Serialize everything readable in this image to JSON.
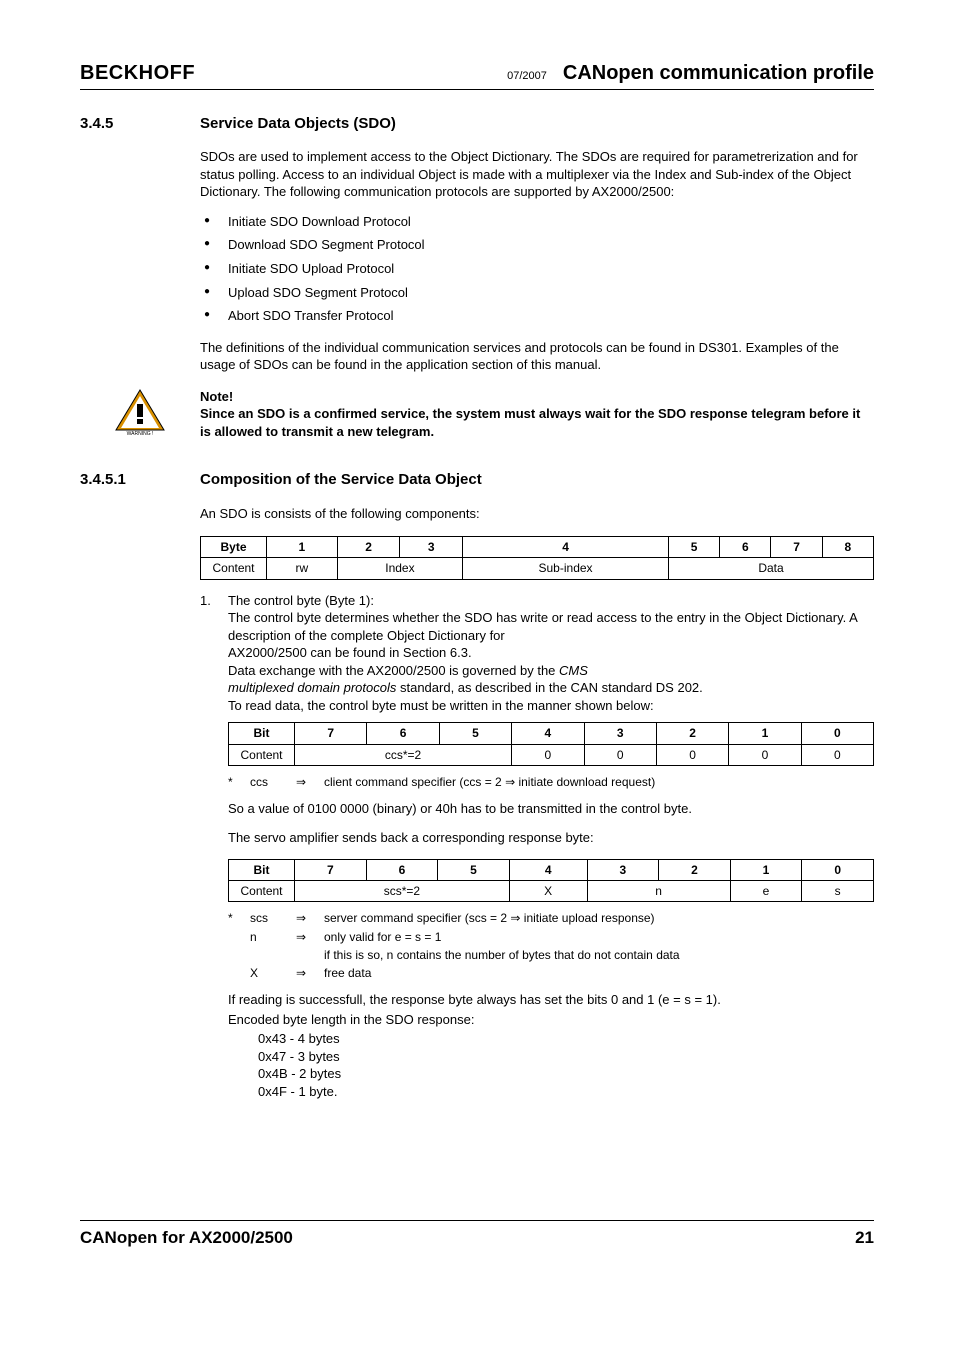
{
  "header": {
    "brand": "BECKHOFF",
    "date": "07/2007",
    "doc_title": "CANopen communication profile"
  },
  "section345": {
    "num": "3.4.5",
    "title": "Service Data Objects (SDO)",
    "intro": "SDOs are used to implement access to the Object Dictionary. The SDOs are required for parametrerization and for status polling. Access to an individual Object is made with a multiplexer via the Index and Sub-index of the Object Dictionary. The following communication protocols are supported by AX2000/2500:",
    "bullets": [
      "Initiate SDO Download Protocol",
      "Download SDO Segment Protocol",
      "Initiate SDO Upload Protocol",
      "Upload SDO Segment Protocol",
      "Abort SDO Transfer Protocol"
    ],
    "post_bullets": "The definitions of the individual communication services and protocols can be found in DS301. Examples of the usage of SDOs can be found in the application section of this manual.",
    "note_label": "Note!",
    "note_text": "Since an SDO is a confirmed service, the system must always wait for the SDO  response telegram before it is allowed to transmit a new telegram."
  },
  "section3451": {
    "num": "3.4.5.1",
    "title": "Composition of the Service Data Object",
    "intro": "An SDO is consists of the following components:",
    "table1": {
      "headers": [
        "Byte",
        "1",
        "2",
        "3",
        "4",
        "5",
        "6",
        "7",
        "8"
      ],
      "row": [
        "Content",
        "rw",
        "Index",
        "Sub-index",
        "Data"
      ]
    },
    "item1_num": "1.",
    "item1_title": "The control byte (Byte 1):",
    "item1_body1": "The control byte determines whether the SDO has write or read access to the entry in the Object Dictionary. A description of the complete Object Dictionary for",
    "item1_body2": "AX2000/2500 can be found in Section 6.3.",
    "item1_body3a": "Data exchange with the AX2000/2500 is governed by the ",
    "item1_body3b": "CMS",
    "item1_body4a": "multiplexed domain protocols",
    "item1_body4b": " standard, as described in the CAN standard DS 202.",
    "item1_body5": "To read data, the control byte must be written in the manner shown below:",
    "table2": {
      "headers": [
        "Bit",
        "7",
        "6",
        "5",
        "4",
        "3",
        "2",
        "1",
        "0"
      ],
      "row": [
        "Content",
        "ccs*=2",
        "0",
        "0",
        "0",
        "0",
        "0"
      ]
    },
    "legend1": {
      "star": "*",
      "abbr": "ccs",
      "arrow": "⇒",
      "text": "client command specifier (ccs = 2 ⇒ initiate download request)"
    },
    "post_t2a": "So a value of 0100 0000 (binary) or 40h has to be transmitted in the control byte.",
    "post_t2b": "The servo amplifier sends back a corresponding response byte:",
    "table3": {
      "headers": [
        "Bit",
        "7",
        "6",
        "5",
        "4",
        "3",
        "2",
        "1",
        "0"
      ],
      "row": [
        "Content",
        "scs*=2",
        "X",
        "n",
        "e",
        "s"
      ]
    },
    "legend3": [
      {
        "star": "*",
        "abbr": "scs",
        "arrow": "⇒",
        "text": "server command specifier (scs = 2 ⇒ initiate upload response)"
      },
      {
        "star": "",
        "abbr": "n",
        "arrow": "⇒",
        "text": "only valid for e = s = 1"
      },
      {
        "star": "",
        "abbr": "",
        "arrow": "",
        "text": "if this is so, n contains the number of bytes that do not contain data"
      },
      {
        "star": "",
        "abbr": "X",
        "arrow": "⇒",
        "text": "free data"
      }
    ],
    "post_t3a": "If reading is successfull, the response byte always has set the bits 0 and 1 (e = s = 1).",
    "post_t3b": "Encoded byte length in the SDO response:",
    "encoded": [
      "0x43 - 4 bytes",
      "0x47 - 3 bytes",
      "0x4B - 2 bytes",
      "0x4F - 1 byte."
    ]
  },
  "footer": {
    "left": "CANopen for AX2000/2500",
    "right": "21"
  }
}
